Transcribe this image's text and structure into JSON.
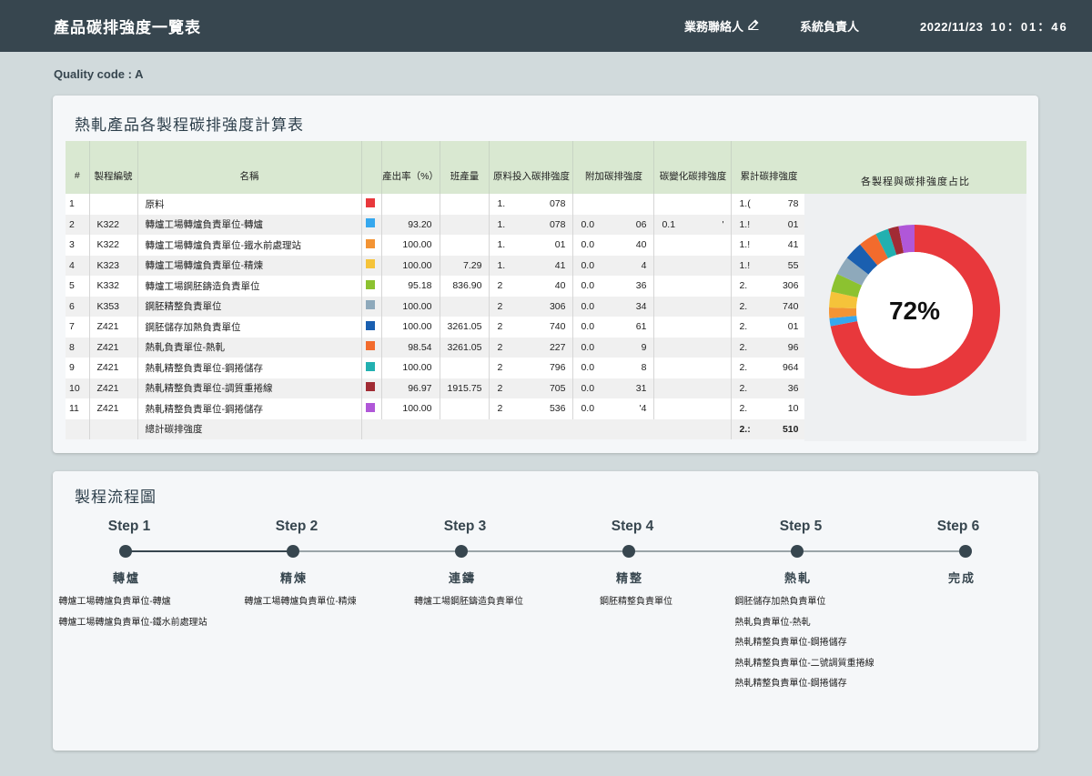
{
  "header": {
    "title": "產品碳排強度一覽表",
    "contact_label": "業務聯絡人",
    "owner_label": "系統負責人",
    "date": "2022/11/23",
    "time": "10：01：46"
  },
  "quality_code": "Quality code : A",
  "calc_card": {
    "title": "熱軋產品各製程碳排強度計算表",
    "columns": [
      "#",
      "製程編號",
      "名稱",
      "",
      "產出率（%）",
      "班產量",
      "原料投入碳排強度",
      "附加碳排強度",
      "碳變化碳排強度",
      "累計碳排強度"
    ],
    "chart_header": "各製程與碳排強度占比",
    "rows": [
      {
        "idx": "1",
        "code": "",
        "name": "原料",
        "color": "#e8383c",
        "rate": "",
        "output": "",
        "c1a": "1.",
        "c1b": "078",
        "c2a": "",
        "c2b": "",
        "c3a": "",
        "c3b": "",
        "c4a": "1.(",
        "c4b": "78"
      },
      {
        "idx": "2",
        "code": "K322",
        "name": "轉爐工場轉爐負責單位-轉爐",
        "color": "#36a8ee",
        "rate": "93.20",
        "output": "",
        "c1a": "1.",
        "c1b": "078",
        "c2a": "0.0",
        "c2b": "06",
        "c3a": "0.1",
        "c3b": "'",
        "c4a": "1.!",
        "c4b": "01"
      },
      {
        "idx": "3",
        "code": "K322",
        "name": "轉爐工場轉爐負責單位-鐵水前處理站",
        "color": "#f39434",
        "rate": "100.00",
        "output": "",
        "c1a": "1.",
        "c1b": "01",
        "c2a": "0.0",
        "c2b": "40",
        "c3a": "",
        "c3b": "",
        "c4a": "1.!",
        "c4b": "41"
      },
      {
        "idx": "4",
        "code": "K323",
        "name": "轉爐工場轉爐負責單位-精煉",
        "color": "#f5c33a",
        "rate": "100.00",
        "output": "7.29",
        "c1a": "1.",
        "c1b": "41",
        "c2a": "0.0",
        "c2b": "4",
        "c3a": "",
        "c3b": "",
        "c4a": "1.!",
        "c4b": "55"
      },
      {
        "idx": "5",
        "code": "K332",
        "name": "轉爐工場鋼胚鑄造負責單位",
        "color": "#8cc230",
        "rate": "95.18",
        "output": "836.90",
        "c1a": "2",
        "c1b": "40",
        "c2a": "0.0",
        "c2b": "36",
        "c3a": "",
        "c3b": "",
        "c4a": "2.",
        "c4b": "306"
      },
      {
        "idx": "6",
        "code": "K353",
        "name": "鋼胚精整負責單位",
        "color": "#8ea9bb",
        "rate": "100.00",
        "output": "",
        "c1a": "2",
        "c1b": "306",
        "c2a": "0.0",
        "c2b": "34",
        "c3a": "",
        "c3b": "",
        "c4a": "2.",
        "c4b": "740"
      },
      {
        "idx": "7",
        "code": "Z421",
        "name": "鋼胚儲存加熱負責單位",
        "color": "#1a5fb0",
        "rate": "100.00",
        "output": "3261.05",
        "c1a": "2",
        "c1b": "740",
        "c2a": "0.0",
        "c2b": "61",
        "c3a": "",
        "c3b": "",
        "c4a": "2.",
        "c4b": "01"
      },
      {
        "idx": "8",
        "code": "Z421",
        "name": "熱軋負責單位-熱軋",
        "color": "#f26b2d",
        "rate": "98.54",
        "output": "3261.05",
        "c1a": "2",
        "c1b": "227",
        "c2a": "0.0",
        "c2b": "9",
        "c3a": "",
        "c3b": "",
        "c4a": "2.",
        "c4b": "96"
      },
      {
        "idx": "9",
        "code": "Z421",
        "name": "熱軋精整負責單位-鋼捲儲存",
        "color": "#22b0b0",
        "rate": "100.00",
        "output": "",
        "c1a": "2",
        "c1b": "796",
        "c2a": "0.0",
        "c2b": "8",
        "c3a": "",
        "c3b": "",
        "c4a": "2.",
        "c4b": "964"
      },
      {
        "idx": "10",
        "code": "Z421",
        "name": "熱軋精整負責單位-調質重捲線",
        "color": "#a12b34",
        "rate": "96.97",
        "output": "1915.75",
        "c1a": "2",
        "c1b": "705",
        "c2a": "0.0",
        "c2b": "31",
        "c3a": "",
        "c3b": "",
        "c4a": "2.",
        "c4b": "36"
      },
      {
        "idx": "11",
        "code": "Z421",
        "name": "熱軋精整負責單位-鋼捲儲存",
        "color": "#b057d8",
        "rate": "100.00",
        "output": "",
        "c1a": "2",
        "c1b": "536",
        "c2a": "0.0",
        "c2b": "'4",
        "c3a": "",
        "c3b": "",
        "c4a": "2.",
        "c4b": "10"
      }
    ],
    "total": {
      "label": "總計碳排強度",
      "a": "2.:",
      "b": "510"
    },
    "donut": {
      "center_label": "72%",
      "shares": [
        {
          "color": "#e8383c",
          "value": 72
        },
        {
          "color": "#36a8ee",
          "value": 1.5
        },
        {
          "color": "#f39434",
          "value": 2
        },
        {
          "color": "#f5c33a",
          "value": 3
        },
        {
          "color": "#8cc230",
          "value": 3.5
        },
        {
          "color": "#8ea9bb",
          "value": 3.5
        },
        {
          "color": "#1a5fb0",
          "value": 3.5
        },
        {
          "color": "#f26b2d",
          "value": 3.5
        },
        {
          "color": "#22b0b0",
          "value": 2.5
        },
        {
          "color": "#a12b34",
          "value": 2
        },
        {
          "color": "#b057d8",
          "value": 3
        }
      ]
    }
  },
  "flow_card": {
    "title": "製程流程圖",
    "steps": [
      {
        "label": "Step 1",
        "name": "轉爐",
        "units": [
          "轉爐工場轉爐負責單位-轉爐",
          "轉爐工場轉爐負責單位-鐵水前處理站"
        ]
      },
      {
        "label": "Step 2",
        "name": "精煉",
        "units": [
          "轉爐工場轉爐負責單位-精煉"
        ]
      },
      {
        "label": "Step 3",
        "name": "連鑄",
        "units": [
          "轉爐工場鋼胚鑄造負責單位"
        ]
      },
      {
        "label": "Step 4",
        "name": "精整",
        "units": [
          "鋼胚精整負責單位"
        ]
      },
      {
        "label": "Step 5",
        "name": "熱軋",
        "units": [
          "鋼胚儲存加熱負責單位",
          "熱軋負責單位-熱軋",
          "熱軋精整負責單位-鋼捲儲存",
          "熱軋精整負責單位-二號調質重捲線",
          "熱軋精整負責單位-鋼捲儲存"
        ]
      },
      {
        "label": "Step 6",
        "name": "完成",
        "units": []
      }
    ]
  }
}
